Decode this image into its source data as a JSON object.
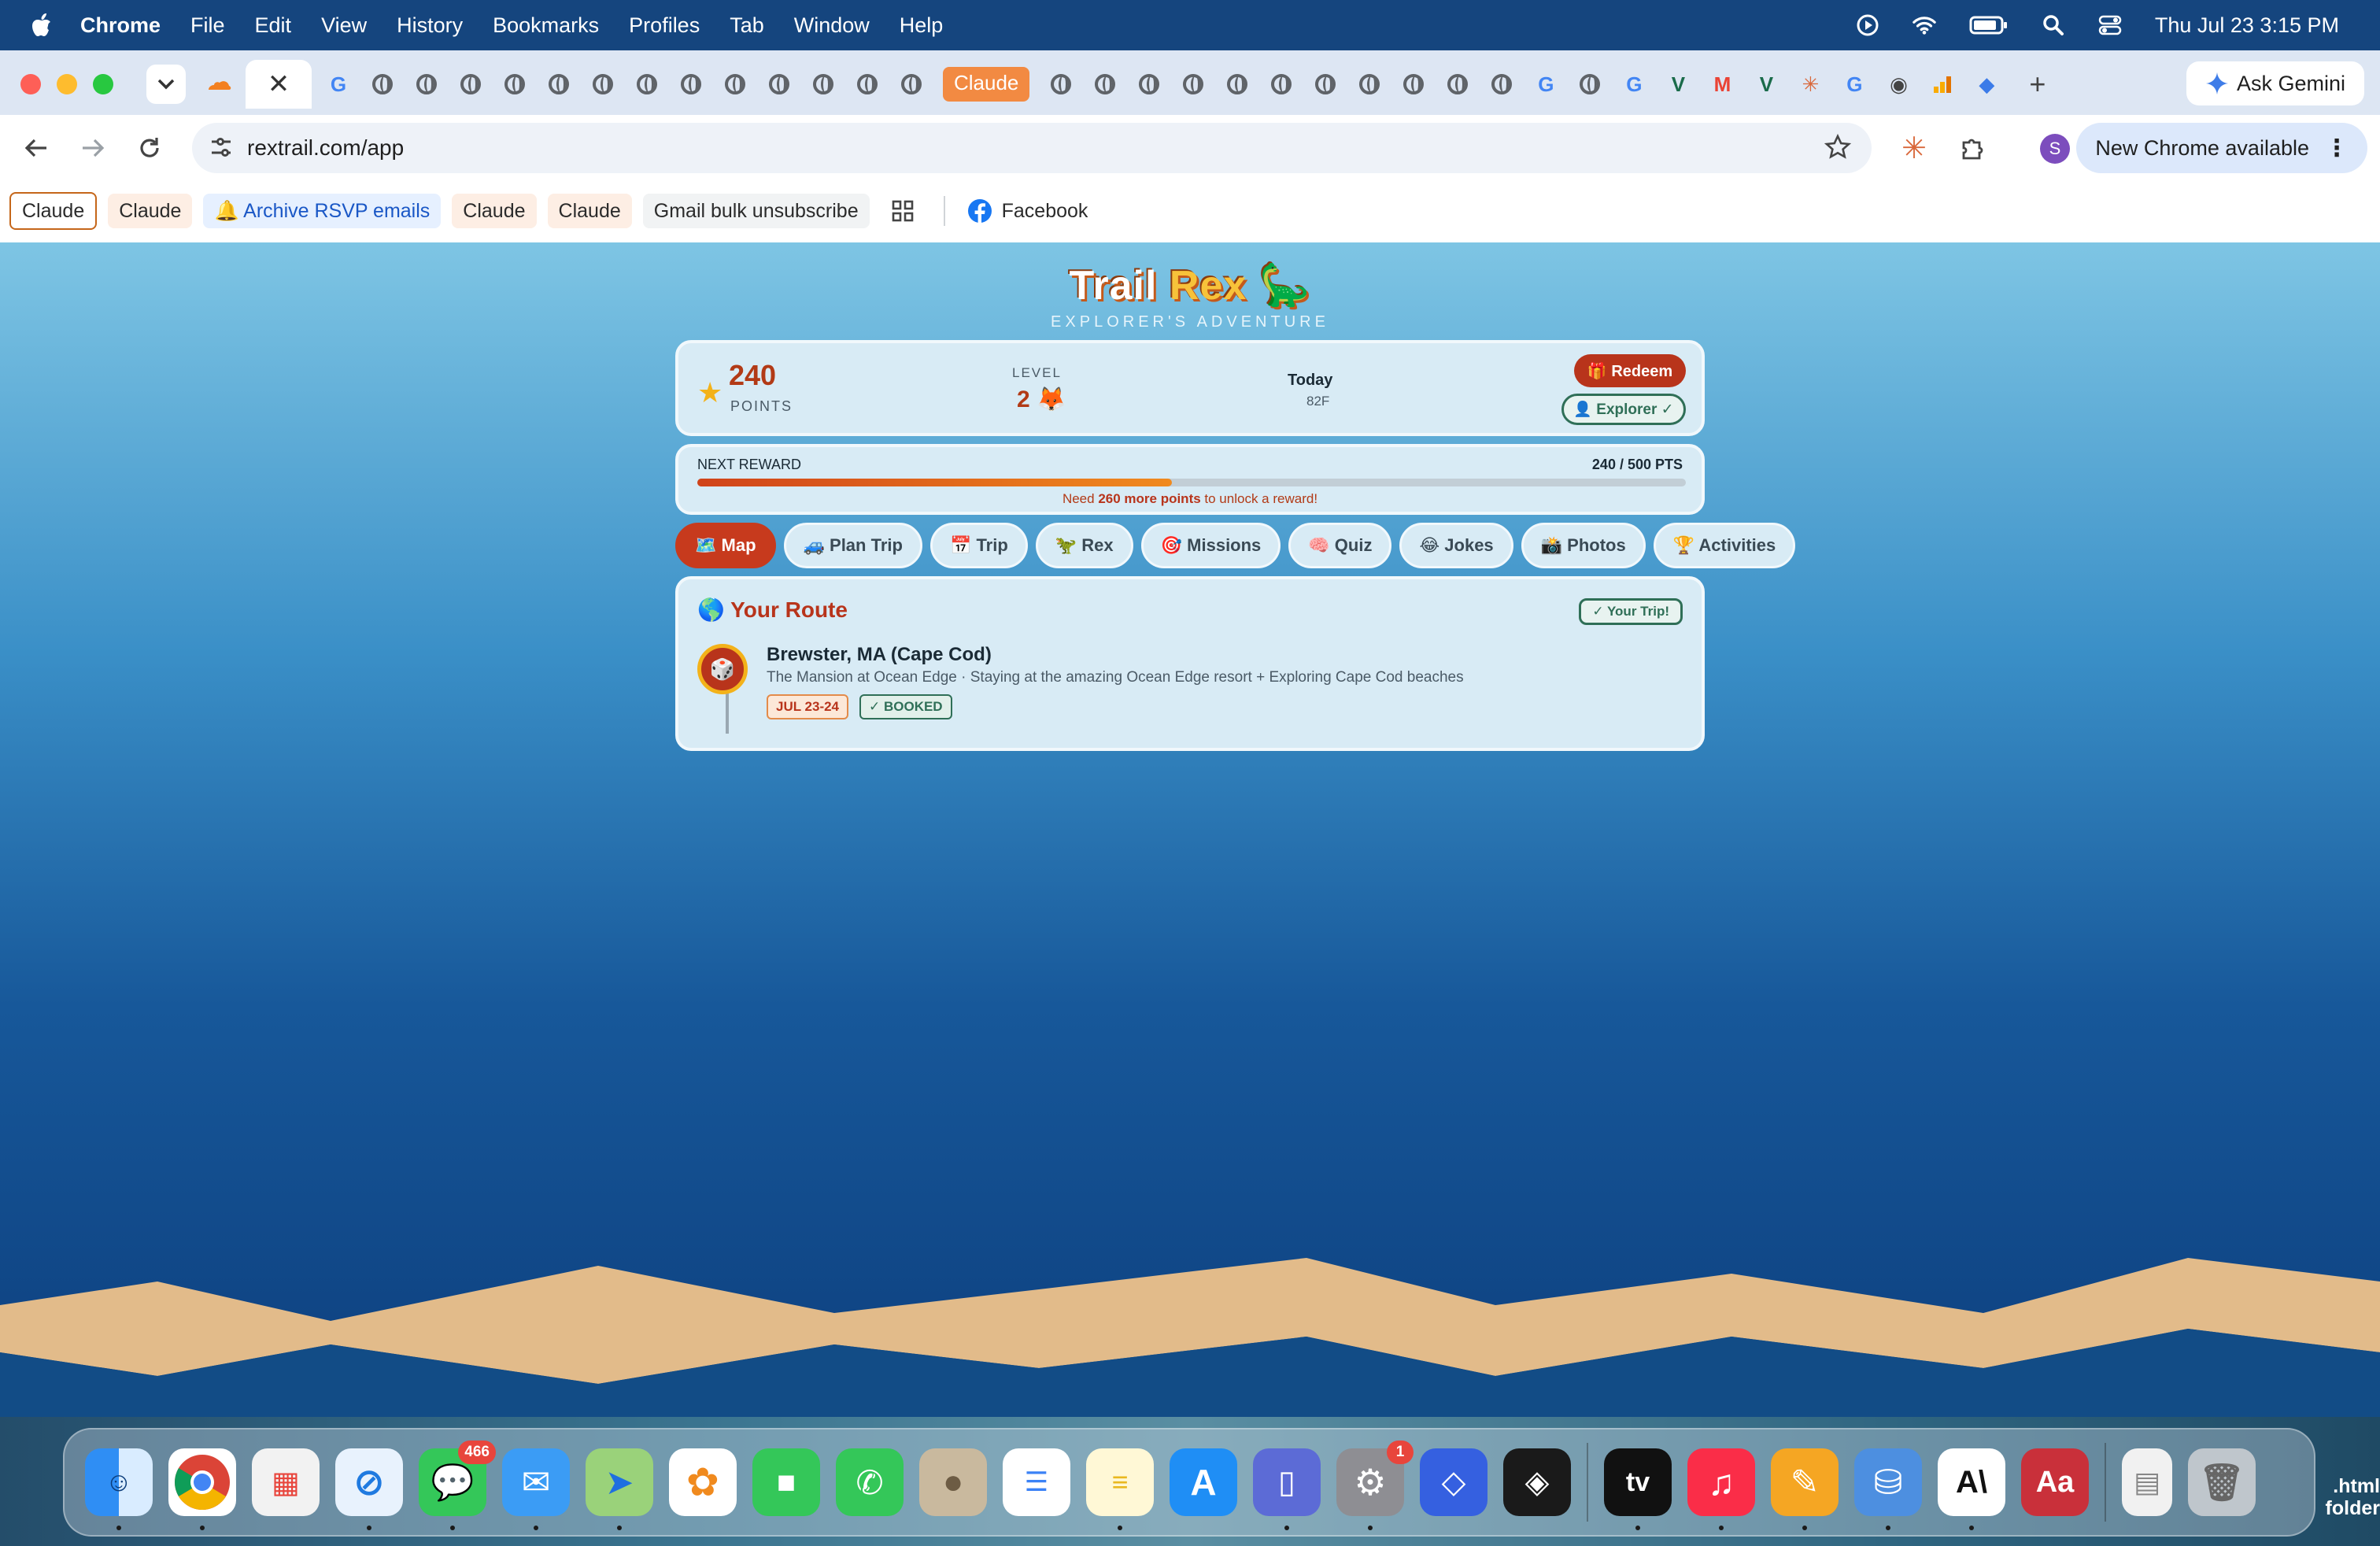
{
  "menubar": {
    "app_name": "Chrome",
    "items": [
      "File",
      "Edit",
      "View",
      "History",
      "Bookmarks",
      "Profiles",
      "Tab",
      "Window",
      "Help"
    ],
    "clock": "Thu Jul 23  3:15 PM"
  },
  "tabs": {
    "claude_tab_label": "Claude",
    "close_glyph": "✕",
    "new_tab_glyph": "+"
  },
  "gemini": {
    "label": "Ask Gemini"
  },
  "address_bar": {
    "url": "rextrail.com/app"
  },
  "update_button": {
    "label": "New Chrome available"
  },
  "profile": {
    "initial": "S"
  },
  "bookmarks": {
    "items": [
      {
        "label": "Claude"
      },
      {
        "label": "Claude"
      },
      {
        "label": "🔔 Archive RSVP emails"
      },
      {
        "label": "Claude"
      },
      {
        "label": "Claude"
      },
      {
        "label": "Gmail bulk unsubscribe"
      }
    ],
    "facebook_label": "Facebook"
  },
  "app": {
    "logo_part1": "Trail",
    "logo_part2": "Rex",
    "logo_emoji": "🦕",
    "tagline": "EXPLORER'S ADVENTURE",
    "stats": {
      "points_value": "240",
      "points_label": "POINTS",
      "level_label": "LEVEL",
      "level_value": "2 🦊",
      "today_label": "Today",
      "today_temp": "82F",
      "redeem_label": "🎁 Redeem",
      "explorer_label": "👤 Explorer ✓"
    },
    "reward": {
      "label": "NEXT REWARD",
      "points_text": "240 / 500 PTS",
      "progress_fraction": 0.48,
      "msg_prefix": "Need ",
      "msg_points": "260 more points",
      "msg_suffix": " to unlock a reward!"
    },
    "nav_tabs": [
      {
        "label": "🗺️ Map"
      },
      {
        "label": "🚙 Plan Trip"
      },
      {
        "label": "📅 Trip"
      },
      {
        "label": "🦖 Rex"
      },
      {
        "label": "🎯 Missions"
      },
      {
        "label": "🧠 Quiz"
      },
      {
        "label": "😂 Jokes"
      },
      {
        "label": "📸 Photos"
      },
      {
        "label": "🏆 Activities"
      }
    ],
    "route": {
      "title": "🌎 Your Route",
      "your_trip_badge": "✓ Your Trip!",
      "stop_icon": "🎲",
      "stop_name": "Brewster, MA (Cape Cod)",
      "stop_desc": "The Mansion at Ocean Edge · Staying at the amazing Ocean Edge resort + Exploring Cape Cod beaches",
      "date_badge": "JUL 23-24",
      "status_badge": "✓ BOOKED"
    }
  },
  "dock": {
    "messages_badge": "466",
    "settings_badge": "1",
    "tv_label": "tv",
    "font_label": "A\\",
    "dict_label": "Aa",
    "folder_label": ".html folder"
  },
  "colors": {
    "accent_red": "#b8341b",
    "success_green": "#2f6f57",
    "menubar_blue": "#15457e"
  }
}
